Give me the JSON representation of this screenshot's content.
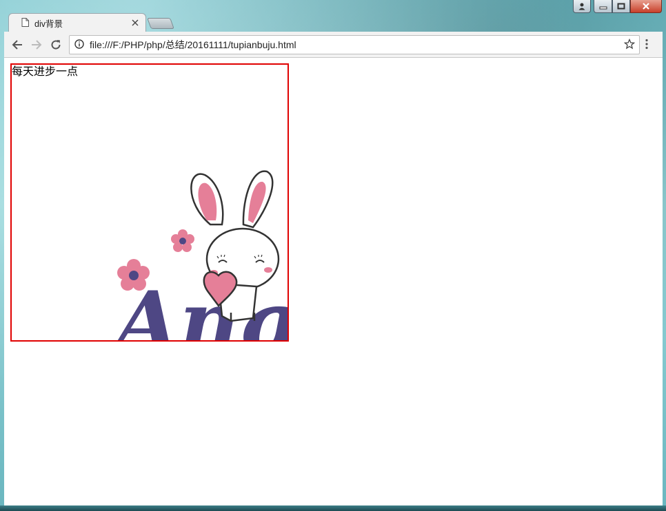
{
  "window": {
    "tab_title": "div背景",
    "url": "file:///F:/PHP/php/总结/20161111/tupianbuju.html"
  },
  "icons": {
    "page": "page-icon",
    "close_tab": "close-icon",
    "back": "back-arrow-icon",
    "forward": "forward-arrow-icon",
    "reload": "reload-icon",
    "info": "info-icon",
    "bookmark": "star-icon",
    "menu": "more-vert-icon",
    "user": "user-icon",
    "minimize": "minimize-icon",
    "maximize": "maximize-icon",
    "close_window": "close-window-icon"
  },
  "content": {
    "div_text": "每天进步一点",
    "image_text": "Angel"
  },
  "colors": {
    "div_border": "#e00000",
    "flower_pink": "#e57f98",
    "lettering_purple": "#4e4784"
  }
}
